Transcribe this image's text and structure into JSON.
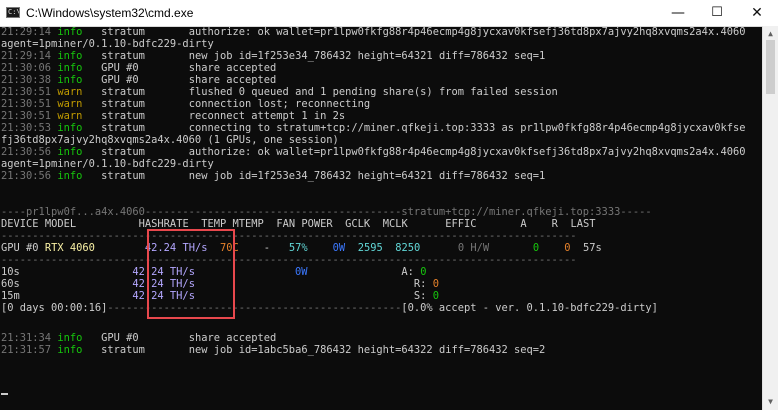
{
  "window": {
    "app_icon_text": "C:\\",
    "title": "C:\\Windows\\system32\\cmd.exe",
    "min_glyph": "—",
    "max_glyph": "☐",
    "close_glyph": "✕"
  },
  "scroll": {
    "up": "▲",
    "down": "▼"
  },
  "log_top": [
    {
      "ts": "21:29:14",
      "level": "info",
      "source": "stratum",
      "msg": "authorize: ok wallet=pr1lpw0fkfg88r4p46ecmp4g8jycxav0kfsefj36td8px7ajvy2hq8xvqms2a4x.4060"
    },
    {
      "cont": "agent=1pminer/0.1.10-bdfc229-dirty"
    },
    {
      "ts": "21:29:14",
      "level": "info",
      "source": "stratum",
      "msg": "new job id=1f253e34_786432 height=64321 diff=786432 seq=1"
    },
    {
      "ts": "21:30:06",
      "level": "info",
      "source": "GPU #0",
      "msg": "share accepted"
    },
    {
      "ts": "21:30:38",
      "level": "info",
      "source": "GPU #0",
      "msg": "share accepted"
    },
    {
      "ts": "21:30:51",
      "level": "warn",
      "source": "stratum",
      "msg": "flushed 0 queued and 1 pending share(s) from failed session"
    },
    {
      "ts": "21:30:51",
      "level": "warn",
      "source": "stratum",
      "msg": "connection lost; reconnecting"
    },
    {
      "ts": "21:30:51",
      "level": "warn",
      "source": "stratum",
      "msg": "reconnect attempt 1 in 2s"
    },
    {
      "ts": "21:30:53",
      "level": "info",
      "source": "stratum",
      "msg": "connecting to stratum+tcp://miner.qfkeji.top:3333 as pr1lpw0fkfg88r4p46ecmp4g8jycxav0kfse"
    },
    {
      "cont": "fj36td8px7ajvy2hq8xvqms2a4x.4060 (1 GPUs, one session)"
    },
    {
      "ts": "21:30:56",
      "level": "info",
      "source": "stratum",
      "msg": "authorize: ok wallet=pr1lpw0fkfg88r4p46ecmp4g8jycxav0kfsefj36td8px7ajvy2hq8xvqms2a4x.4060"
    },
    {
      "cont": "agent=1pminer/0.1.10-bdfc229-dirty"
    },
    {
      "ts": "21:30:56",
      "level": "info",
      "source": "stratum",
      "msg": "new job id=1f253e34_786432 height=64321 diff=786432 seq=1"
    }
  ],
  "dash": {
    "sep_top": {
      "lead": "----",
      "wallet_label": "pr1lpw0f...a4x.4060",
      "mid": "-----------------------------------------",
      "pool_label": "stratum+tcp://miner.qfkeji.top:3333",
      "tail": "-----"
    },
    "header": {
      "device": "DEVICE",
      "model": "MODEL",
      "hashrate": "HASHRATE",
      "temp": "TEMP",
      "mtemp": "MTEMP",
      "fan": "FAN",
      "power": "POWER",
      "gclk": "GCLK",
      "mclk": "MCLK",
      "effic": "EFFIC",
      "a": "A",
      "r": "R",
      "last": "LAST"
    },
    "sep": "--------------------------------------------------------------------------------------------",
    "gpu": {
      "device": "GPU #0",
      "model": "RTX 4060",
      "hashrate": "42.24 TH/s",
      "temp": "70C",
      "mtemp": "-",
      "fan": "57%",
      "power": "0W",
      "gclk": "2595",
      "mclk": "8250",
      "effic": "0 H/W",
      "a": "0",
      "r": "0",
      "last": "57s"
    },
    "summary": [
      {
        "label": "10s",
        "hashrate": "42.24 TH/s",
        "power": "0W",
        "stat_label": "A:",
        "stat_val": "0"
      },
      {
        "label": "60s",
        "hashrate": "42.24 TH/s",
        "stat_label": "R:",
        "stat_val": "0"
      },
      {
        "label": "15m",
        "hashrate": "42.24 TH/s",
        "stat_label": "S:",
        "stat_val": "0"
      }
    ],
    "footer": {
      "uptime": "[0 days 00:00:16]",
      "dashes": "-----------------------------------------------",
      "status": "[0.0% accept - ver. 0.1.10-bdfc229-dirty]"
    }
  },
  "log_bottom": [
    {
      "ts": "21:31:34",
      "level": "info",
      "source": "GPU #0",
      "msg": "share accepted"
    },
    {
      "ts": "21:31:57",
      "level": "info",
      "source": "stratum",
      "msg": "new job id=1abc5ba6_786432 height=64322 diff=786432 seq=2"
    }
  ],
  "colors": {
    "background": "#0c0c0c",
    "text": "#cccccc",
    "timestamp": "#767676",
    "info": "#16c60c",
    "warn": "#c19c00",
    "model": "#f9f1a5",
    "hashrate": "#b4a7ff",
    "temp": "#e5812b",
    "fan": "#61d6d6",
    "power": "#3b78ff",
    "highlight_box": "#e8484d"
  }
}
